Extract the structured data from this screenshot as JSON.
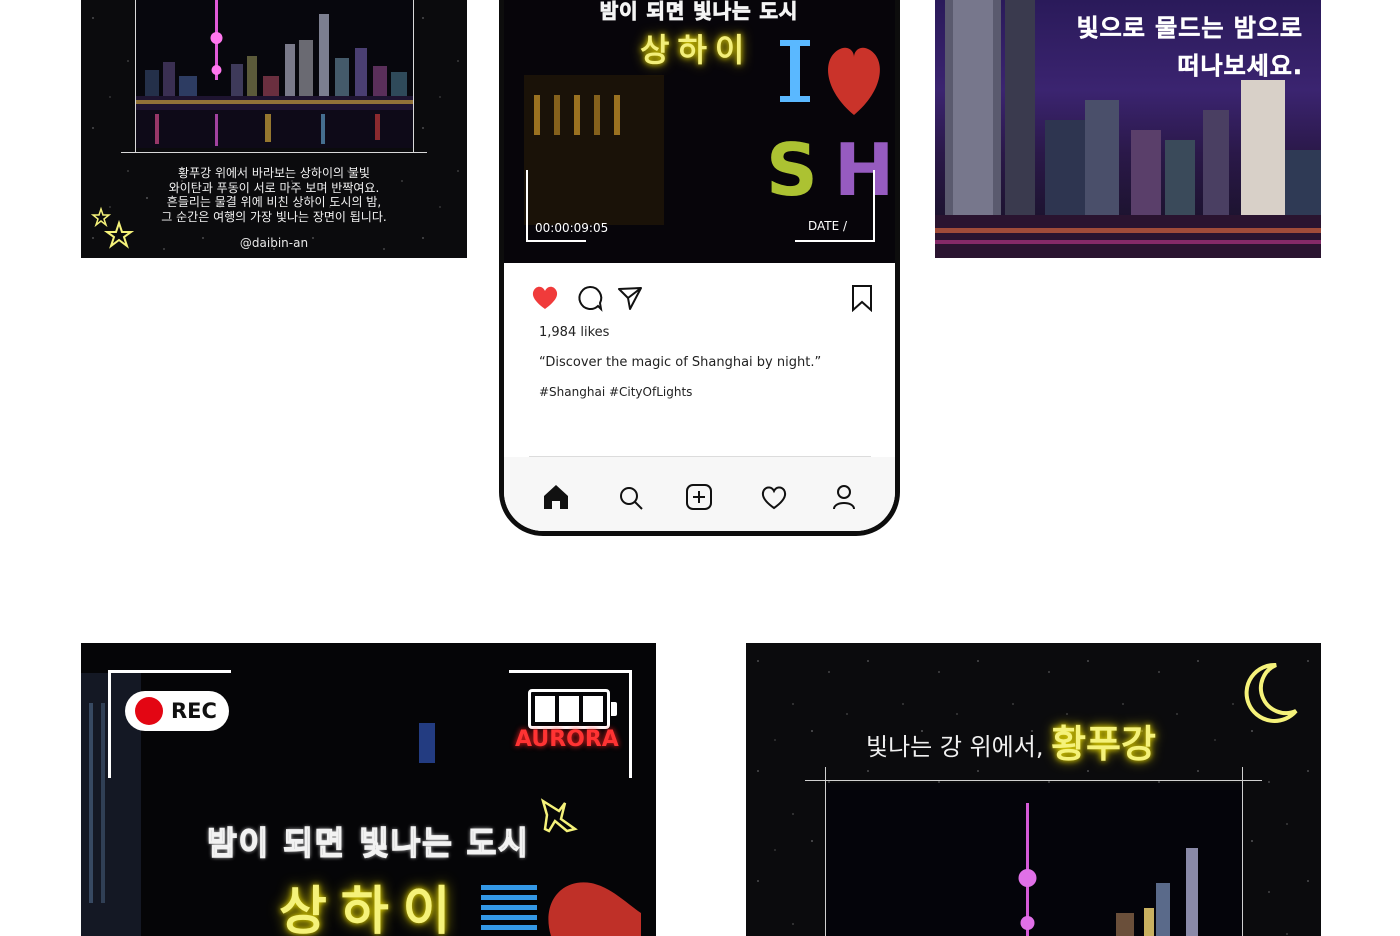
{
  "card1": {
    "caption_lines": [
      "황푸강 위에서 바라보는 상하이의 불빛",
      "와이탄과 푸동이 서로 마주 보며 반짝여요.",
      "흔들리는 물결 위에 비친 상하이 도시의 밤,",
      "그 순간은 여행의 가장 빛나는 장면이 됩니다."
    ],
    "handle": "@daibin-an"
  },
  "phone": {
    "shot_title": "밤이 되면 빛나는 도시",
    "shot_city": "상하이",
    "timer": "00:00:09:05",
    "date": "DATE   /",
    "likes": "1,984 likes",
    "quote": "“Discover the magic of Shanghai by night.”",
    "tags": "#Shanghai #CityOfLights",
    "colors": {
      "like_heart": "#f03b3b",
      "neon_yellow": "#f5f27a"
    }
  },
  "card3": {
    "line1": "빛으로 물드는 밤으로",
    "line2": "떠나보세요."
  },
  "card4": {
    "rec_label": "REC",
    "sign": "AURORA",
    "subtitle": "밤이 되면 빛나는 도시",
    "city": "상하이",
    "battery_level": 1.0
  },
  "card5": {
    "headline": "빛나는 강 위에서,",
    "highlight": "황푸강"
  }
}
